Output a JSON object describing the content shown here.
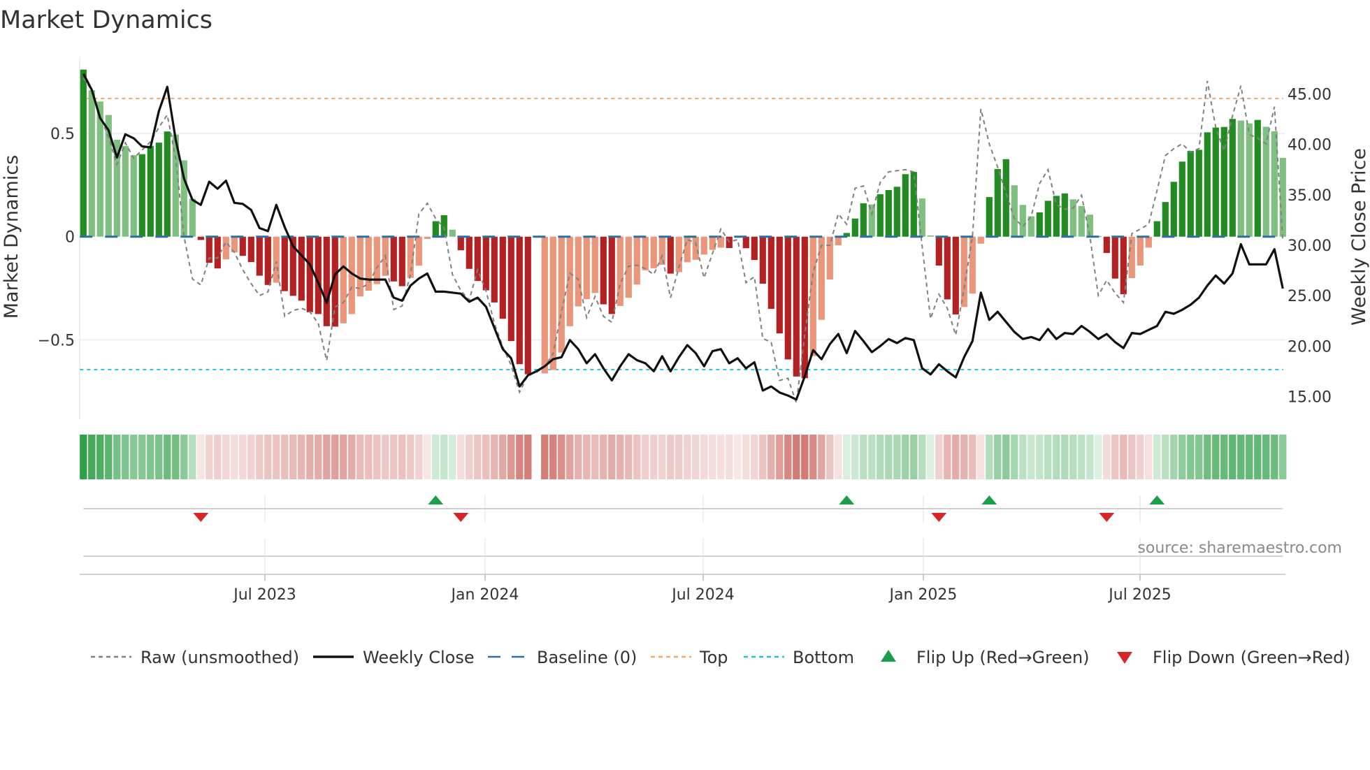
{
  "chart_data": {
    "type": "bar",
    "title": "Market Dynamics",
    "ylabel": "Market Dynamics",
    "y2label": "Weekly Close Price",
    "x_unit": "week index",
    "ylim": [
      -0.885,
      0.873
    ],
    "y2lim": [
      12.75,
      48.7
    ],
    "yticks": [
      {
        "value": 0.5,
        "label": "0.5"
      },
      {
        "value": 0,
        "label": "0"
      },
      {
        "value": -0.5,
        "label": "−0.5"
      }
    ],
    "y2ticks": [
      {
        "value": 45,
        "label": "45.00"
      },
      {
        "value": 40,
        "label": "40.00"
      },
      {
        "value": 35,
        "label": "35.00"
      },
      {
        "value": 30,
        "label": "30.00"
      },
      {
        "value": 25,
        "label": "25.00"
      },
      {
        "value": 20,
        "label": "20.00"
      },
      {
        "value": 15,
        "label": "15.00"
      }
    ],
    "xticks": [
      {
        "value": 21.64,
        "label": "Jul 2023"
      },
      {
        "value": 47.89,
        "label": "Jan 2024"
      },
      {
        "value": 73.89,
        "label": "Jul 2024"
      },
      {
        "value": 100.14,
        "label": "Jan 2025"
      },
      {
        "value": 125.98,
        "label": "Jul 2025"
      }
    ],
    "grid": true,
    "levels": {
      "baseline": 0,
      "top": 0.67,
      "bottom": -0.644
    },
    "market_dynamics": [
      0.81,
      0.71,
      0.655,
      0.59,
      0.47,
      0.44,
      0.395,
      0.4,
      0.44,
      0.456,
      0.51,
      0.495,
      0.37,
      0.184,
      -0.016,
      -0.127,
      -0.154,
      -0.11,
      -0.076,
      -0.093,
      -0.123,
      -0.189,
      -0.234,
      -0.223,
      -0.264,
      -0.287,
      -0.31,
      -0.366,
      -0.375,
      -0.434,
      -0.436,
      -0.42,
      -0.375,
      -0.29,
      -0.262,
      -0.23,
      -0.19,
      -0.217,
      -0.24,
      -0.2,
      -0.141,
      -0.011,
      0.075,
      0.104,
      0.034,
      -0.066,
      -0.156,
      -0.215,
      -0.26,
      -0.319,
      -0.398,
      -0.506,
      -0.618,
      -0.667,
      null,
      -0.663,
      -0.646,
      -0.562,
      -0.434,
      -0.338,
      -0.303,
      -0.273,
      -0.328,
      -0.375,
      -0.336,
      -0.296,
      -0.232,
      -0.163,
      -0.153,
      -0.136,
      -0.179,
      -0.172,
      -0.124,
      -0.112,
      -0.087,
      -0.064,
      -0.053,
      -0.055,
      -0.005,
      -0.056,
      -0.113,
      -0.228,
      -0.35,
      -0.469,
      -0.595,
      -0.678,
      -0.686,
      -0.579,
      -0.403,
      -0.208,
      -0.042,
      0.018,
      0.088,
      0.162,
      0.156,
      0.206,
      0.226,
      0.242,
      0.303,
      0.314,
      0.185,
      0.006,
      -0.14,
      -0.304,
      -0.377,
      -0.341,
      -0.276,
      -0.034,
      0.192,
      0.328,
      0.376,
      0.249,
      0.154,
      0.099,
      0.118,
      0.174,
      0.198,
      0.21,
      0.181,
      0.149,
      0.107,
      0.003,
      -0.079,
      -0.203,
      -0.279,
      -0.201,
      -0.14,
      -0.053,
      0.075,
      0.168,
      0.266,
      0.364,
      0.416,
      0.421,
      0.506,
      0.529,
      0.532,
      0.571,
      0.563,
      0.549,
      0.566,
      0.533,
      0.511,
      0.382
    ],
    "raw_unsmoothed": [
      0.77,
      0.71,
      0.585,
      0.48,
      0.35,
      0.455,
      0.38,
      0.42,
      0.46,
      0.53,
      0.59,
      0.38,
      0.0,
      -0.205,
      -0.234,
      -0.104,
      -0.104,
      -0.025,
      -0.076,
      -0.16,
      -0.228,
      -0.285,
      -0.268,
      -0.12,
      -0.386,
      -0.358,
      -0.347,
      -0.364,
      -0.42,
      -0.6,
      -0.341,
      -0.319,
      -0.245,
      -0.251,
      -0.228,
      -0.149,
      -0.093,
      -0.353,
      -0.336,
      -0.183,
      0.111,
      0.162,
      0.088,
      0.043,
      -0.183,
      -0.262,
      -0.307,
      -0.16,
      -0.262,
      -0.42,
      -0.533,
      -0.624,
      -0.754,
      -0.669,
      -0.658,
      -0.63,
      -0.567,
      -0.364,
      -0.177,
      -0.206,
      -0.392,
      -0.29,
      -0.386,
      -0.415,
      -0.228,
      -0.143,
      -0.138,
      -0.155,
      -0.183,
      -0.093,
      -0.296,
      -0.149,
      -0.014,
      -0.03,
      -0.2,
      -0.081,
      0.037,
      -0.025,
      -0.014,
      -0.223,
      -0.194,
      -0.494,
      -0.511,
      -0.697,
      -0.686,
      -0.805,
      -0.477,
      -0.172,
      -0.042,
      -0.042,
      0.111,
      0.06,
      0.235,
      0.246,
      0.111,
      0.263,
      0.314,
      0.32,
      0.325,
      0.314,
      -0.047,
      -0.398,
      -0.279,
      -0.347,
      -0.477,
      -0.251,
      0.003,
      0.619,
      0.45,
      0.337,
      0.21,
      0.088,
      0.049,
      0.099,
      0.258,
      0.325,
      0.156,
      0.133,
      0.139,
      0.201,
      0.0,
      -0.285,
      -0.211,
      -0.273,
      -0.319,
      0.015,
      0.037,
      0.06,
      0.224,
      0.393,
      0.427,
      0.45,
      0.41,
      0.427,
      0.755,
      0.529,
      0.416,
      0.585,
      0.732,
      0.495,
      0.478,
      0.45,
      0.63,
      -0.025
    ],
    "weekly_close": [
      47.0,
      45.4,
      42.6,
      41.4,
      38.7,
      41.0,
      40.6,
      39.8,
      39.7,
      43.3,
      45.7,
      40.5,
      36.6,
      34.5,
      34.0,
      36.3,
      35.6,
      36.4,
      34.2,
      34.1,
      33.5,
      31.7,
      31.4,
      34.0,
      31.8,
      29.9,
      29.0,
      28.1,
      26.3,
      24.3,
      27.1,
      27.9,
      27.2,
      26.7,
      26.6,
      26.6,
      26.6,
      24.8,
      24.5,
      26.0,
      26.7,
      27.2,
      25.4,
      25.4,
      25.3,
      25.2,
      24.4,
      24.8,
      23.9,
      21.8,
      19.7,
      18.8,
      16.0,
      17.1,
      17.5,
      18.0,
      18.7,
      18.9,
      20.6,
      19.7,
      18.3,
      19.2,
      17.8,
      16.6,
      18.0,
      19.2,
      18.6,
      18.3,
      17.5,
      19.0,
      17.5,
      18.9,
      20.1,
      19.3,
      18.0,
      19.5,
      19.7,
      18.3,
      18.8,
      17.8,
      18.4,
      15.6,
      16.0,
      15.4,
      15.1,
      14.7,
      17.0,
      19.6,
      18.7,
      20.2,
      21.2,
      19.3,
      21.5,
      20.5,
      19.4,
      20.0,
      20.7,
      20.3,
      20.8,
      20.6,
      17.8,
      17.2,
      18.2,
      17.5,
      16.9,
      18.9,
      20.5,
      25.3,
      22.6,
      23.4,
      22.4,
      21.4,
      20.7,
      20.9,
      20.6,
      21.7,
      20.7,
      21.3,
      21.2,
      22.0,
      21.4,
      20.7,
      21.2,
      20.4,
      19.8,
      21.3,
      21.2,
      21.6,
      22.0,
      23.4,
      23.2,
      23.6,
      24.1,
      24.8,
      26.0,
      27.0,
      26.2,
      27.2,
      30.1,
      28.1,
      28.1,
      28.1,
      29.6,
      25.7
    ],
    "flip_up": [
      42,
      91,
      108,
      128
    ],
    "flip_down": [
      14,
      45,
      102,
      122
    ],
    "legend": {
      "position": "bottom",
      "items": [
        {
          "label": "Raw (unsmoothed)",
          "kind": "dashed-line",
          "color": "#808080"
        },
        {
          "label": "Weekly Close",
          "kind": "line",
          "color": "#111111"
        },
        {
          "label": "Baseline (0)",
          "kind": "dashed-line",
          "color": "#2b6fa3"
        },
        {
          "label": "Top",
          "kind": "dotted-line",
          "color": "#f0a868"
        },
        {
          "label": "Bottom",
          "kind": "dotted-line",
          "color": "#22c3d6"
        },
        {
          "label": "Flip Up (Red→Green)",
          "kind": "triangle-up",
          "color": "#1a9e4a"
        },
        {
          "label": "Flip Down (Green→Red)",
          "kind": "triangle-down",
          "color": "#d62728"
        }
      ]
    },
    "colors": {
      "pos_strong": "#228b22",
      "pos_weak": "#7fbf7f",
      "neg_strong": "#b22222",
      "neg_weak": "#e9967a",
      "close": "#111111",
      "raw": "#808080",
      "baseline": "#2b6fa3",
      "top": "#f0a868",
      "bottom": "#22c3d6",
      "flip_up": "#1a9e4a",
      "flip_down": "#d62728"
    }
  },
  "source": "source: sharemaestro.com"
}
